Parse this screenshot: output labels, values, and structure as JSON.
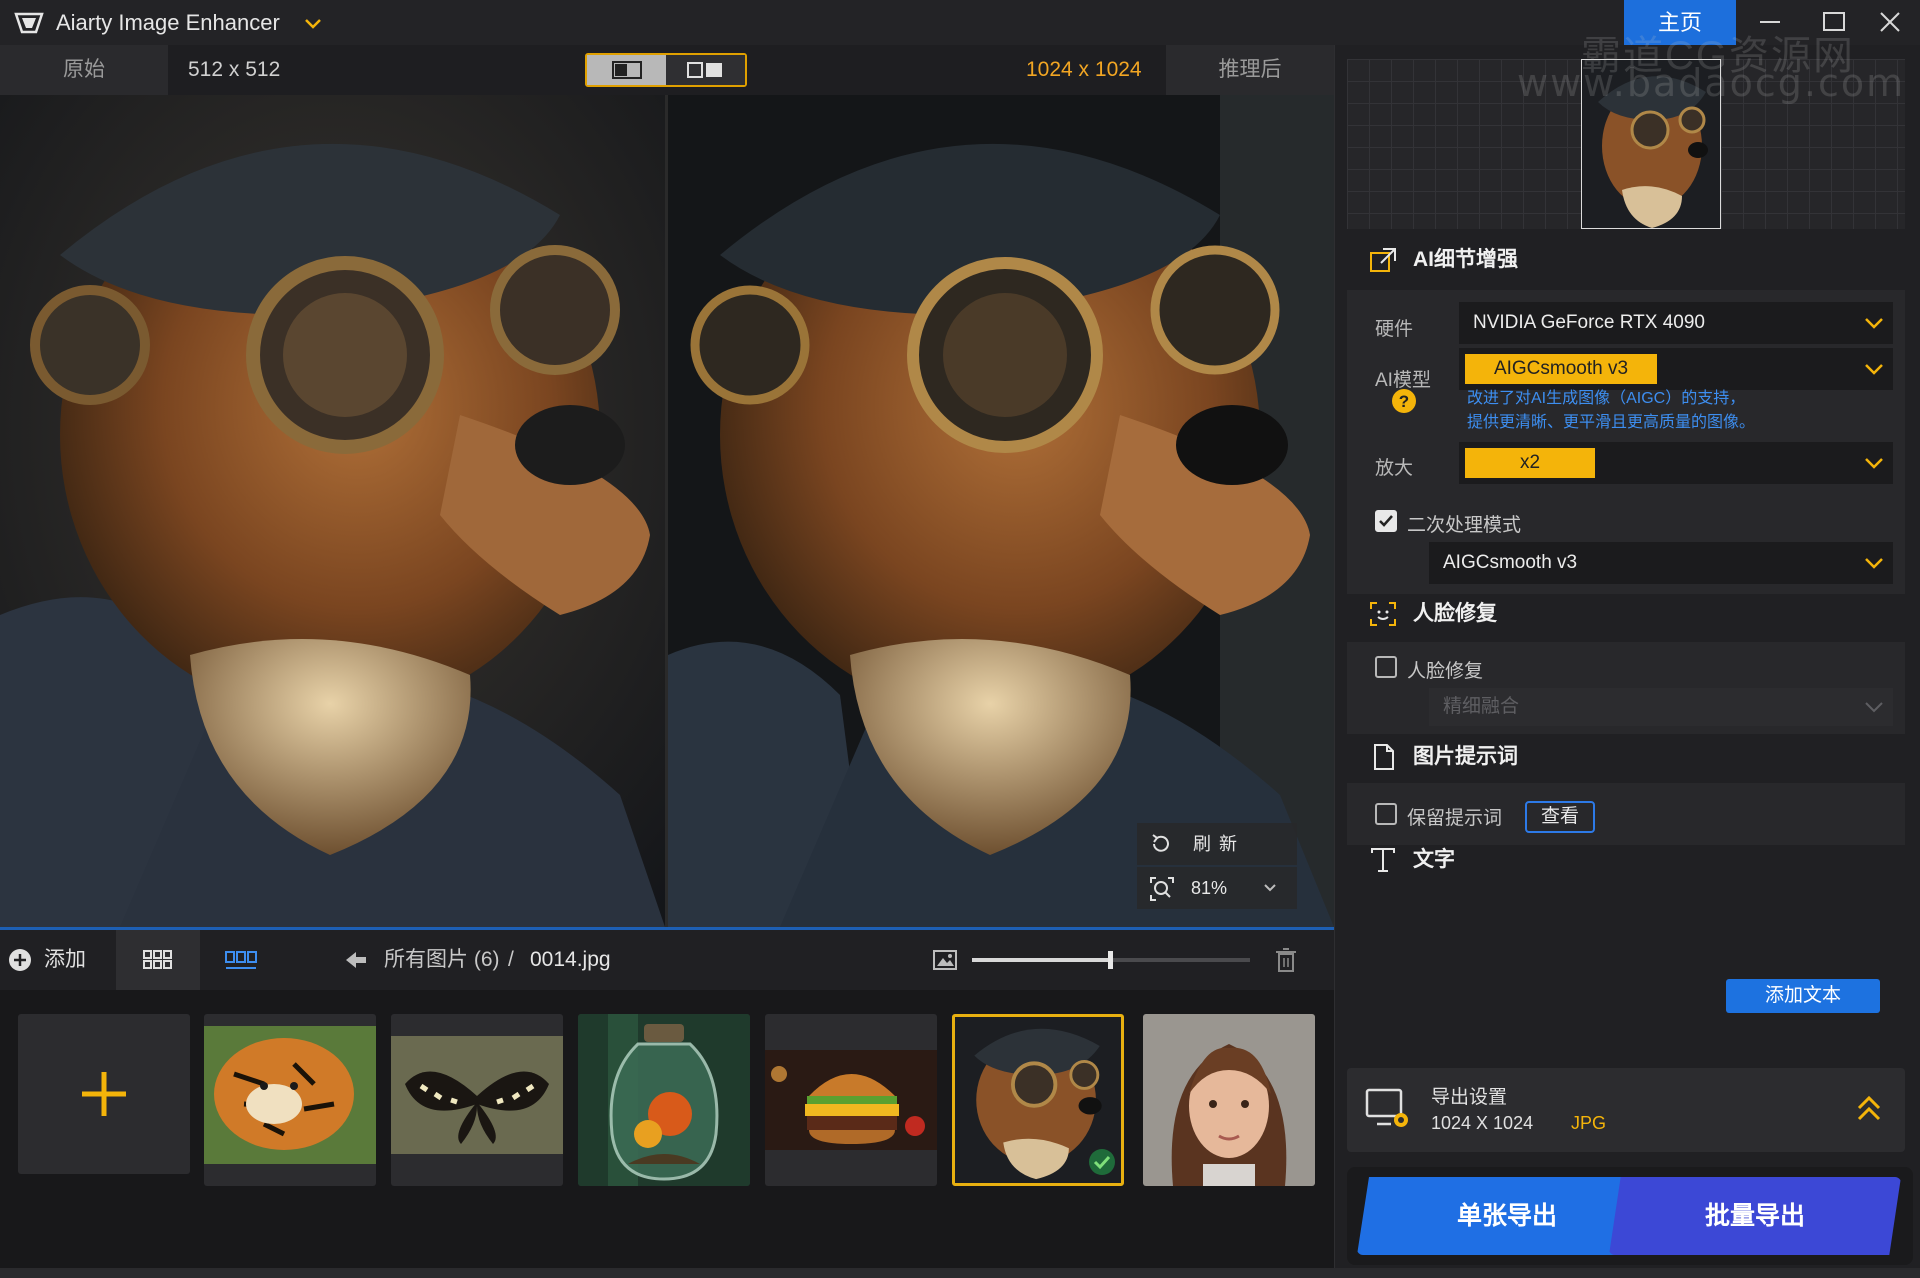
{
  "window": {
    "title": "Aiarty Image Enhancer",
    "home_label": "主页",
    "watermark_line1": "霸道CG资源网",
    "watermark_line2": "www.badaocg.com"
  },
  "compare": {
    "original_label": "原始",
    "original_size": "512 x 512",
    "result_size": "1024 x 1024",
    "result_label": "推理后"
  },
  "preview": {
    "refresh_label": "刷新",
    "zoom_value": "81%"
  },
  "gallery_toolbar": {
    "add_label": "添加",
    "crumb_all": "所有图片 (6)",
    "crumb_sep": "/",
    "crumb_file": "0014.jpg",
    "thumb_slider_fraction": 0.5
  },
  "gallery": {
    "items": [
      {
        "subject": "tiger"
      },
      {
        "subject": "butterfly"
      },
      {
        "subject": "jar-terrarium"
      },
      {
        "subject": "burger"
      },
      {
        "subject": "steampunk-dog",
        "selected": true
      },
      {
        "subject": "woman-portrait"
      }
    ]
  },
  "panel": {
    "ai_section_title": "AI细节增强",
    "hardware_label": "硬件",
    "hardware_value": "NVIDIA GeForce RTX 4090",
    "model_label": "AI模型",
    "model_value": "AIGCsmooth  v3",
    "model_hint_line1": "改进了对AI生成图像（AIGC）的支持，",
    "model_hint_line2": "提供更清晰、更平滑且更高质量的图像。",
    "scale_label": "放大",
    "scale_value": "x2",
    "secondary_label": "二次处理模式",
    "secondary_checked": true,
    "secondary_model": "AIGCsmooth  v3",
    "face_section_title": "人脸修复",
    "face_checkbox_label": "人脸修复",
    "face_checked": false,
    "face_mode_placeholder": "精细融合",
    "prompt_section_title": "图片提示词",
    "keep_prompt_label": "保留提示词",
    "view_button": "查看",
    "text_section_title": "文字",
    "add_text_button": "添加文本",
    "export_title": "导出设置",
    "export_size": "1024 X 1024",
    "export_format": "JPG",
    "single_export": "单张导出",
    "batch_export": "批量导出"
  },
  "colors": {
    "accent_yellow": "#f4b40a",
    "accent_blue": "#1f6fe4",
    "batch_purple": "#3c48d6",
    "hint_blue": "#3d8ef0"
  }
}
